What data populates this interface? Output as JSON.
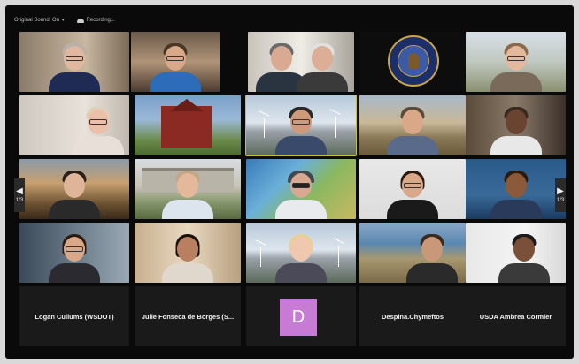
{
  "toolbar": {
    "original_sound": "Original Sound: On",
    "recording": "Recording..."
  },
  "pager": {
    "prev_page": "1/3",
    "next_page": "1/3"
  },
  "name_tiles": [
    {
      "name": "Logan Cullums (WSDOT)"
    },
    {
      "name": "Julie Fonseca de Borges (S..."
    },
    {
      "name": "",
      "avatar_letter": "D"
    },
    {
      "name": "Despina.Chymeftos"
    },
    {
      "name": "USDA Ambrea Cormier"
    }
  ],
  "seal": {
    "text": "COLUMBIA RIVER GORGE COMMISSION"
  },
  "colors": {
    "active_speaker": "#c8c030",
    "avatar_d": "#c77bd5"
  }
}
